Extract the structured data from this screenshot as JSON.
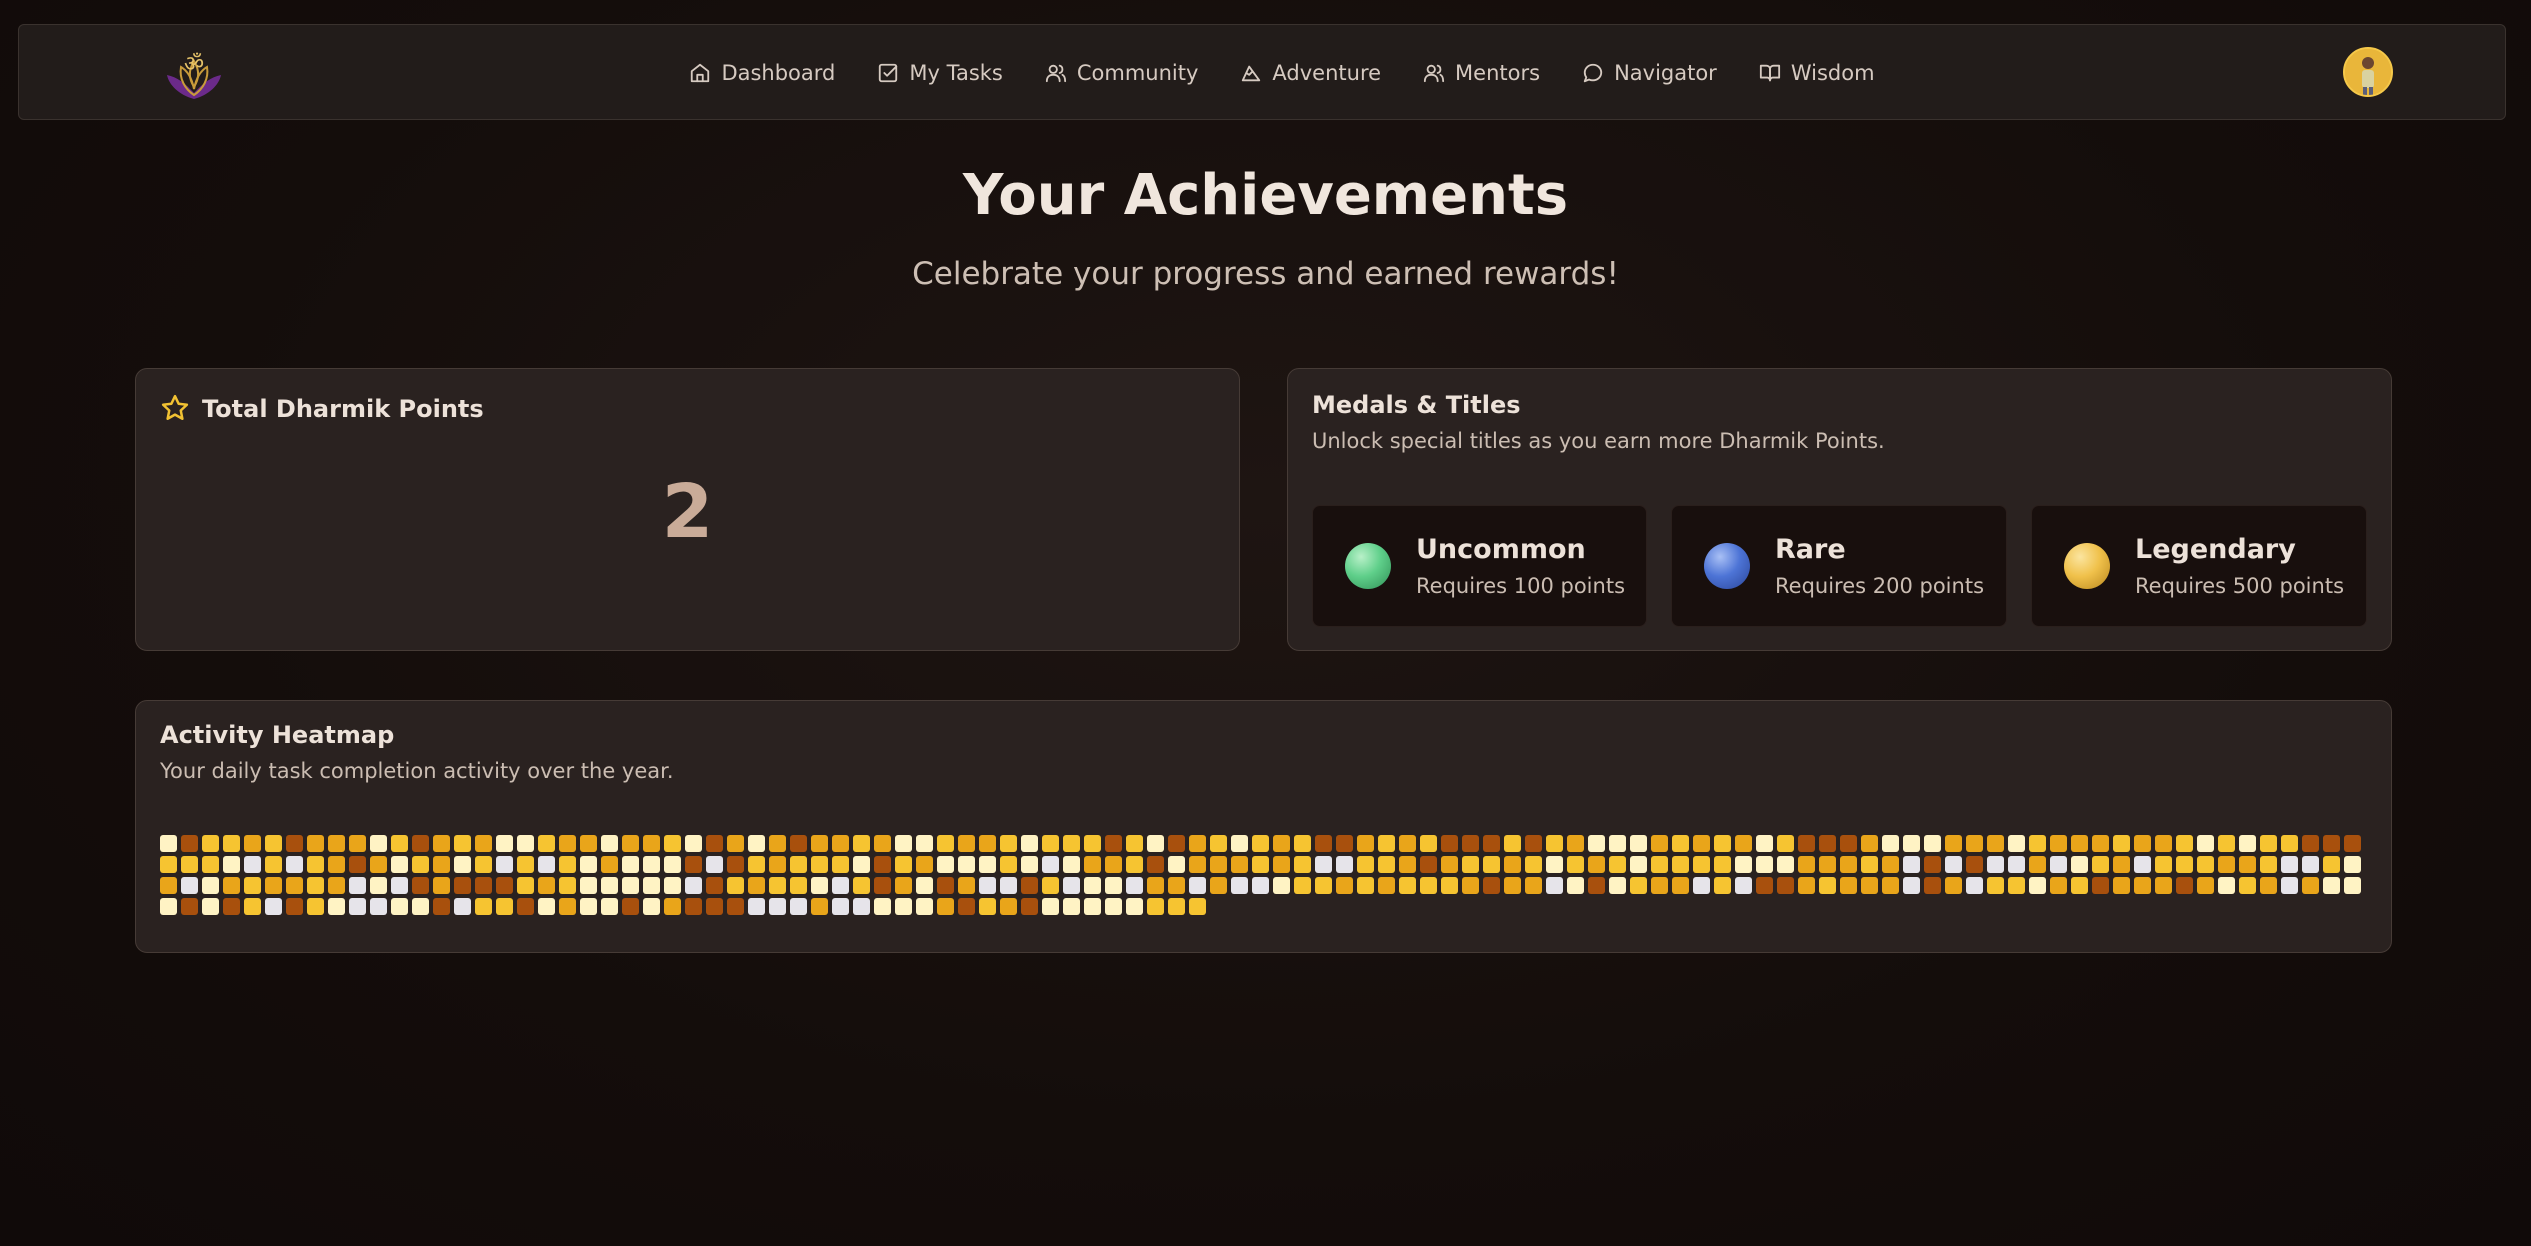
{
  "nav": {
    "logo_alt": "Om lotus logo",
    "links": [
      {
        "label": "Dashboard",
        "icon": "home-icon"
      },
      {
        "label": "My Tasks",
        "icon": "check-square-icon"
      },
      {
        "label": "Community",
        "icon": "users-icon"
      },
      {
        "label": "Adventure",
        "icon": "mountain-icon"
      },
      {
        "label": "Mentors",
        "icon": "users-icon"
      },
      {
        "label": "Navigator",
        "icon": "message-circle-icon"
      },
      {
        "label": "Wisdom",
        "icon": "book-open-icon"
      }
    ]
  },
  "hero": {
    "title": "Your Achievements",
    "subtitle": "Celebrate your progress and earned rewards!"
  },
  "points": {
    "title": "Total Dharmik Points",
    "value": "2",
    "icon": "star-icon",
    "icon_color": "#f2c232"
  },
  "medals": {
    "title": "Medals & Titles",
    "description": "Unlock special titles as you earn more Dharmik Points.",
    "items": [
      {
        "name": "Uncommon",
        "requirement": "Requires 100 points",
        "color": "#5fcf8a"
      },
      {
        "name": "Rare",
        "requirement": "Requires 200 points",
        "color": "#4d74d6"
      },
      {
        "name": "Legendary",
        "requirement": "Requires 500 points",
        "color": "#f0c14b"
      }
    ]
  },
  "heatmap": {
    "title": "Activity Heatmap",
    "description": "Your daily task completion activity over the year.",
    "palette": {
      "0": "#e6e4ea",
      "1": "#fff3c4",
      "2": "#f6c431",
      "3": "#e9a51a",
      "4": "#a8500d"
    },
    "rows": [
      "1422324333124323112331332143134332311233212224214321232443232444242311132323124443111333123332332121224443303",
      "2221020234312312020213111404232221423111210133241333232002234322321232122221113332304040030123022233200213404",
      "3013233230104344423211111042322102431430042011033030012232322234330141233020443233304302213243334312303110304",
      "1414204210011402241311413444000300111342341111122211103031222121211000213221112431111220030111444331111212210"
    ],
    "last_row_count": 50
  }
}
